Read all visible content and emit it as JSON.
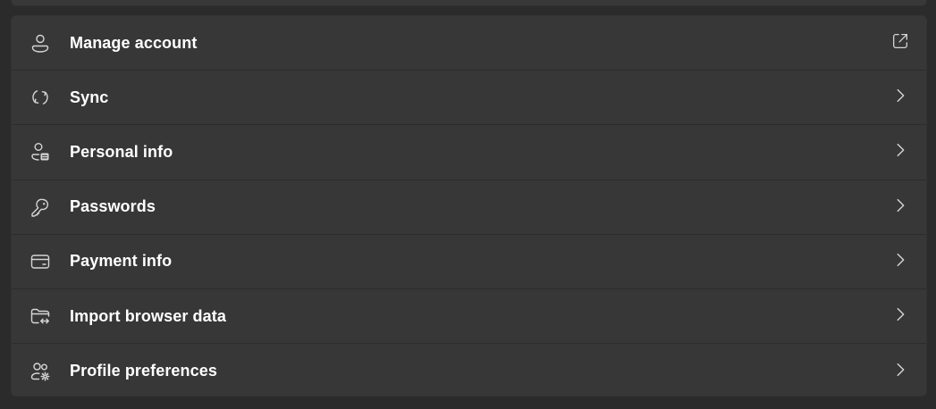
{
  "colors": {
    "background": "#2b2b2b",
    "card": "#373737",
    "divider": "#2c2c2c",
    "text": "#ffffff",
    "icon": "#d6d6d6"
  },
  "settings": {
    "items": [
      {
        "label": "Manage account",
        "icon": "person-icon",
        "trailing": "open-external-icon"
      },
      {
        "label": "Sync",
        "icon": "sync-icon",
        "trailing": "chevron-right-icon"
      },
      {
        "label": "Personal info",
        "icon": "person-card-icon",
        "trailing": "chevron-right-icon"
      },
      {
        "label": "Passwords",
        "icon": "key-icon",
        "trailing": "chevron-right-icon"
      },
      {
        "label": "Payment info",
        "icon": "credit-card-icon",
        "trailing": "chevron-right-icon"
      },
      {
        "label": "Import browser data",
        "icon": "folder-import-icon",
        "trailing": "chevron-right-icon"
      },
      {
        "label": "Profile preferences",
        "icon": "people-settings-icon",
        "trailing": "chevron-right-icon"
      }
    ]
  }
}
